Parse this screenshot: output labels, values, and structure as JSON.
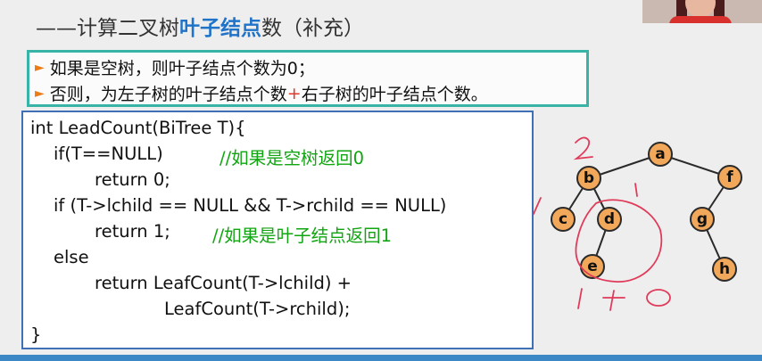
{
  "title": {
    "prefix": "——计算二叉树",
    "highlight": "叶子结点",
    "suffix": "数（补充）"
  },
  "bullets": {
    "line1": "如果是空树，则叶子结点个数为0；",
    "line2_a": "否则，为左子树的叶子结点个数",
    "line2_plus": "+",
    "line2_b": "右子树的叶子结点个数。"
  },
  "code": {
    "l1": "int LeadCount(BiTree T){",
    "l2": "if(T==NULL)",
    "l2_comment": "//如果是空树返回0",
    "l3": "return 0;",
    "l4": "if (T->lchild == NULL && T->rchild == NULL)",
    "l5": "return 1;",
    "l5_comment": "//如果是叶子结点返回1",
    "l6": "else",
    "l7": "return LeafCount(T->lchild) +",
    "l8": "LeafCount(T->rchild);",
    "l9": "}"
  },
  "tree": {
    "nodes": [
      "a",
      "b",
      "f",
      "c",
      "d",
      "g",
      "e",
      "h"
    ]
  },
  "colors": {
    "accent": "#1f73c8",
    "comment": "#12a512",
    "bullet_border": "#37b4a6",
    "code_border": "#3f6fb5",
    "node_fill": "#f2a85a",
    "ink": "#e03b5a"
  },
  "icons": [
    "bullet-arrow-icon",
    "webcam-thumbnail"
  ]
}
